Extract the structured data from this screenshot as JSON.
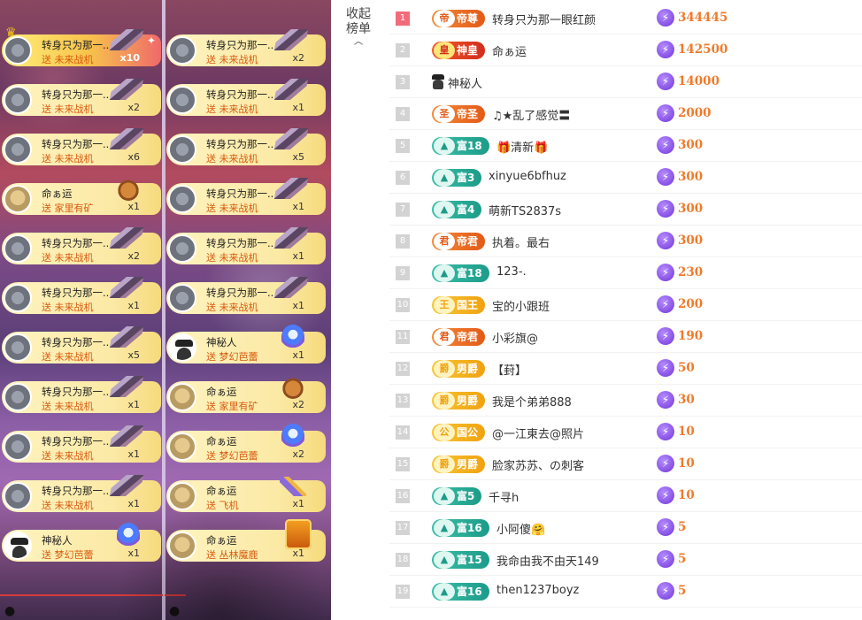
{
  "gift_feed": {
    "left": [
      {
        "name": "转身只为那一...",
        "gift": "送 未来战机",
        "count": "x10",
        "avatar": "grey",
        "icon": "jet-gift-icon",
        "cls": "jet",
        "highlight": true
      },
      {
        "name": "转身只为那一...",
        "gift": "送 未来战机",
        "count": "x2",
        "avatar": "grey",
        "icon": "jet-gift-icon",
        "cls": "jet"
      },
      {
        "name": "转身只为那一...",
        "gift": "送 未来战机",
        "count": "x6",
        "avatar": "grey",
        "icon": "jet-gift-icon",
        "cls": "jet"
      },
      {
        "name": "命ぁ运",
        "gift": "送 家里有矿",
        "count": "x1",
        "avatar": "cat",
        "icon": "bear-gift-icon",
        "cls": "bear"
      },
      {
        "name": "转身只为那一...",
        "gift": "送 未来战机",
        "count": "x2",
        "avatar": "grey",
        "icon": "jet-gift-icon",
        "cls": "jet"
      },
      {
        "name": "转身只为那一...",
        "gift": "送 未来战机",
        "count": "x1",
        "avatar": "grey",
        "icon": "jet-gift-icon",
        "cls": "jet"
      },
      {
        "name": "转身只为那一...",
        "gift": "送 未来战机",
        "count": "x5",
        "avatar": "grey",
        "icon": "jet-gift-icon",
        "cls": "jet"
      },
      {
        "name": "转身只为那一...",
        "gift": "送 未来战机",
        "count": "x1",
        "avatar": "grey",
        "icon": "jet-gift-icon",
        "cls": "jet"
      },
      {
        "name": "转身只为那一...",
        "gift": "送 未来战机",
        "count": "x1",
        "avatar": "grey",
        "icon": "jet-gift-icon",
        "cls": "jet"
      },
      {
        "name": "转身只为那一...",
        "gift": "送 未来战机",
        "count": "x1",
        "avatar": "grey",
        "icon": "jet-gift-icon",
        "cls": "jet"
      },
      {
        "name": "神秘人",
        "gift": "送 梦幻芭蕾",
        "count": "x1",
        "avatar": "hat",
        "icon": "ballet-gift-icon",
        "cls": "ball"
      }
    ],
    "right": [
      {
        "name": "转身只为那一...",
        "gift": "送 未来战机",
        "count": "x2",
        "avatar": "grey",
        "icon": "jet-gift-icon",
        "cls": "jet"
      },
      {
        "name": "转身只为那一...",
        "gift": "送 未来战机",
        "count": "x1",
        "avatar": "grey",
        "icon": "jet-gift-icon",
        "cls": "jet"
      },
      {
        "name": "转身只为那一...",
        "gift": "送 未来战机",
        "count": "x5",
        "avatar": "grey",
        "icon": "jet-gift-icon",
        "cls": "jet"
      },
      {
        "name": "转身只为那一...",
        "gift": "送 未来战机",
        "count": "x1",
        "avatar": "grey",
        "icon": "jet-gift-icon",
        "cls": "jet"
      },
      {
        "name": "转身只为那一...",
        "gift": "送 未来战机",
        "count": "x1",
        "avatar": "grey",
        "icon": "jet-gift-icon",
        "cls": "jet"
      },
      {
        "name": "转身只为那一...",
        "gift": "送 未来战机",
        "count": "x1",
        "avatar": "grey",
        "icon": "jet-gift-icon",
        "cls": "jet"
      },
      {
        "name": "神秘人",
        "gift": "送 梦幻芭蕾",
        "count": "x1",
        "avatar": "hat",
        "icon": "ballet-gift-icon",
        "cls": "ball"
      },
      {
        "name": "命ぁ运",
        "gift": "送 家里有矿",
        "count": "x2",
        "avatar": "cat",
        "icon": "bear-gift-icon",
        "cls": "bear"
      },
      {
        "name": "命ぁ运",
        "gift": "送 梦幻芭蕾",
        "count": "x2",
        "avatar": "cat",
        "icon": "ballet-gift-icon",
        "cls": "ball"
      },
      {
        "name": "命ぁ运",
        "gift": "送 飞机",
        "count": "x1",
        "avatar": "cat",
        "icon": "plane-gift-icon",
        "cls": "plane"
      },
      {
        "name": "命ぁ运",
        "gift": "送 丛林魔鹿",
        "count": "x1",
        "avatar": "cat",
        "icon": "forest-deer-gift-icon",
        "cls": "forest"
      }
    ]
  },
  "ranking": {
    "collapse_label_1": "收起",
    "collapse_label_2": "榜单",
    "collapse_icon": "^",
    "rows": [
      {
        "rank": "1",
        "badge": "帝尊",
        "badge_icon": "帝",
        "style": "orange",
        "name": "转身只为那一眼红颜",
        "score": "344445"
      },
      {
        "rank": "2",
        "badge": "神皇",
        "badge_icon": "皇",
        "style": "red",
        "name": "命ぁ运",
        "score": "142500"
      },
      {
        "rank": "3",
        "badge": "",
        "badge_icon": "",
        "style": "",
        "name": "神秘人",
        "score": "14000"
      },
      {
        "rank": "4",
        "badge": "帝圣",
        "badge_icon": "圣",
        "style": "orange",
        "name": "♫★乱了感觉〓",
        "score": "2000"
      },
      {
        "rank": "5",
        "badge": "富18",
        "badge_icon": "▲",
        "style": "teal",
        "name": "🎁清新🎁",
        "score": "300"
      },
      {
        "rank": "6",
        "badge": "富3",
        "badge_icon": "▲",
        "style": "teal",
        "name": "xinyue6bfhuz",
        "score": "300"
      },
      {
        "rank": "7",
        "badge": "富4",
        "badge_icon": "▲",
        "style": "teal",
        "name": "萌新TS2837s",
        "score": "300"
      },
      {
        "rank": "8",
        "badge": "帝君",
        "badge_icon": "君",
        "style": "orange",
        "name": "执着。最右",
        "score": "300"
      },
      {
        "rank": "9",
        "badge": "富18",
        "badge_icon": "▲",
        "style": "teal",
        "name": "123-.",
        "score": "230"
      },
      {
        "rank": "10",
        "badge": "国王",
        "badge_icon": "王",
        "style": "gold",
        "name": "宝的小跟班",
        "score": "200"
      },
      {
        "rank": "11",
        "badge": "帝君",
        "badge_icon": "君",
        "style": "orange",
        "name": "小彩旗@",
        "score": "190"
      },
      {
        "rank": "12",
        "badge": "男爵",
        "badge_icon": "爵",
        "style": "gold",
        "name": "【葑】",
        "score": "50"
      },
      {
        "rank": "13",
        "badge": "男爵",
        "badge_icon": "爵",
        "style": "gold",
        "name": "我是个弟弟888",
        "score": "30"
      },
      {
        "rank": "14",
        "badge": "国公",
        "badge_icon": "公",
        "style": "gold",
        "name": "@一江東去@照片",
        "score": "10"
      },
      {
        "rank": "15",
        "badge": "男爵",
        "badge_icon": "爵",
        "style": "gold",
        "name": "脸家苏苏、の刺客",
        "score": "10"
      },
      {
        "rank": "16",
        "badge": "富5",
        "badge_icon": "▲",
        "style": "teal",
        "name": "千寻h",
        "score": "10"
      },
      {
        "rank": "17",
        "badge": "富16",
        "badge_icon": "▲",
        "style": "teal",
        "name": "小阿傻🤗",
        "score": "5"
      },
      {
        "rank": "18",
        "badge": "富15",
        "badge_icon": "▲",
        "style": "teal",
        "name": "我命由我不由天149",
        "score": "5"
      },
      {
        "rank": "19",
        "badge": "富16",
        "badge_icon": "▲",
        "style": "teal",
        "name": "then1237boyz",
        "score": "5"
      }
    ]
  },
  "colors": {
    "score": "#f07a2a",
    "coin": "#7236d8",
    "rank1": "#f26b7b"
  }
}
